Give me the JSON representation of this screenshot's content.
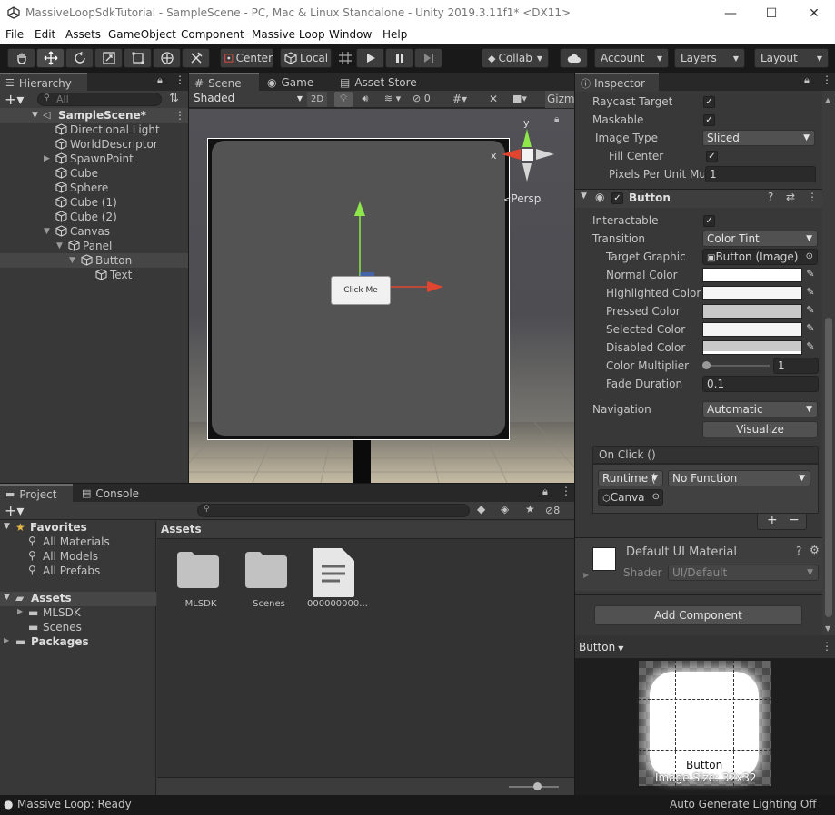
{
  "window": {
    "title": "MassiveLoopSdkTutorial - SampleScene - PC, Mac & Linux Standalone - Unity 2019.3.11f1* <DX11>",
    "minimize": "—",
    "maximize": "☐",
    "close": "✕"
  },
  "menu": [
    "File",
    "Edit",
    "Assets",
    "GameObject",
    "Component",
    "Massive Loop",
    "Window",
    "Help"
  ],
  "toolbar": {
    "center": "Center",
    "local": "Local",
    "collab": "Collab",
    "account": "Account",
    "layers": "Layers",
    "layout": "Layout"
  },
  "hierarchy": {
    "tab": "Hierarchy",
    "search_placeholder": "All",
    "scene": "SampleScene*",
    "items": [
      {
        "label": "Directional Light"
      },
      {
        "label": "WorldDescriptor"
      },
      {
        "label": "SpawnPoint"
      },
      {
        "label": "Cube"
      },
      {
        "label": "Sphere"
      },
      {
        "label": "Cube (1)"
      },
      {
        "label": "Cube (2)"
      },
      {
        "label": "Canvas"
      },
      {
        "label": "Panel"
      },
      {
        "label": "Button"
      },
      {
        "label": "Text"
      }
    ]
  },
  "scene": {
    "tabs": [
      "Scene",
      "Game",
      "Asset Store"
    ],
    "shading": "Shaded",
    "mode2d": "2D",
    "hidden_count": "0",
    "gizmos": "Gizm",
    "persp": "Persp",
    "axis_y": "y",
    "axis_x": "x",
    "button_text": "Click Me"
  },
  "inspector": {
    "tab": "Inspector",
    "raycast_target": "Raycast Target",
    "maskable": "Maskable",
    "image_type": "Image Type",
    "image_type_value": "Sliced",
    "fill_center": "Fill Center",
    "pixels_per_unit": "Pixels Per Unit Mul",
    "pixels_per_unit_value": "1",
    "button_component": "Button",
    "interactable": "Interactable",
    "transition": "Transition",
    "transition_value": "Color Tint",
    "target_graphic": "Target Graphic",
    "target_graphic_value": "Button (Image)",
    "normal_color": "Normal Color",
    "highlighted_color": "Highlighted Color",
    "pressed_color": "Pressed Color",
    "selected_color": "Selected Color",
    "disabled_color": "Disabled Color",
    "color_multiplier": "Color Multiplier",
    "color_multiplier_value": "1",
    "fade_duration": "Fade Duration",
    "fade_duration_value": "0.1",
    "navigation": "Navigation",
    "navigation_value": "Automatic",
    "visualize": "Visualize",
    "on_click": "On Click ()",
    "runtime": "Runtime (",
    "no_function": "No Function",
    "object": "Canva",
    "add": "+",
    "remove": "−",
    "material_name": "Default UI Material",
    "shader_label": "Shader",
    "shader_value": "UI/Default",
    "add_component": "Add Component",
    "preview_dropdown": "Button",
    "preview_name": "Button",
    "image_size": "Image Size: 32x32"
  },
  "project": {
    "tabs": [
      "Project",
      "Console"
    ],
    "hidden_count": "8",
    "favorites": "Favorites",
    "favorites_items": [
      "All Materials",
      "All Models",
      "All Prefabs"
    ],
    "assets": "Assets",
    "assets_children": [
      "MLSDK",
      "Scenes"
    ],
    "packages": "Packages",
    "breadcrumb": "Assets",
    "files": [
      {
        "name": "MLSDK",
        "kind": "folder"
      },
      {
        "name": "Scenes",
        "kind": "folder"
      },
      {
        "name": "000000000...",
        "kind": "file"
      }
    ]
  },
  "status": {
    "left": "Massive Loop: Ready",
    "right": "Auto Generate Lighting Off"
  }
}
